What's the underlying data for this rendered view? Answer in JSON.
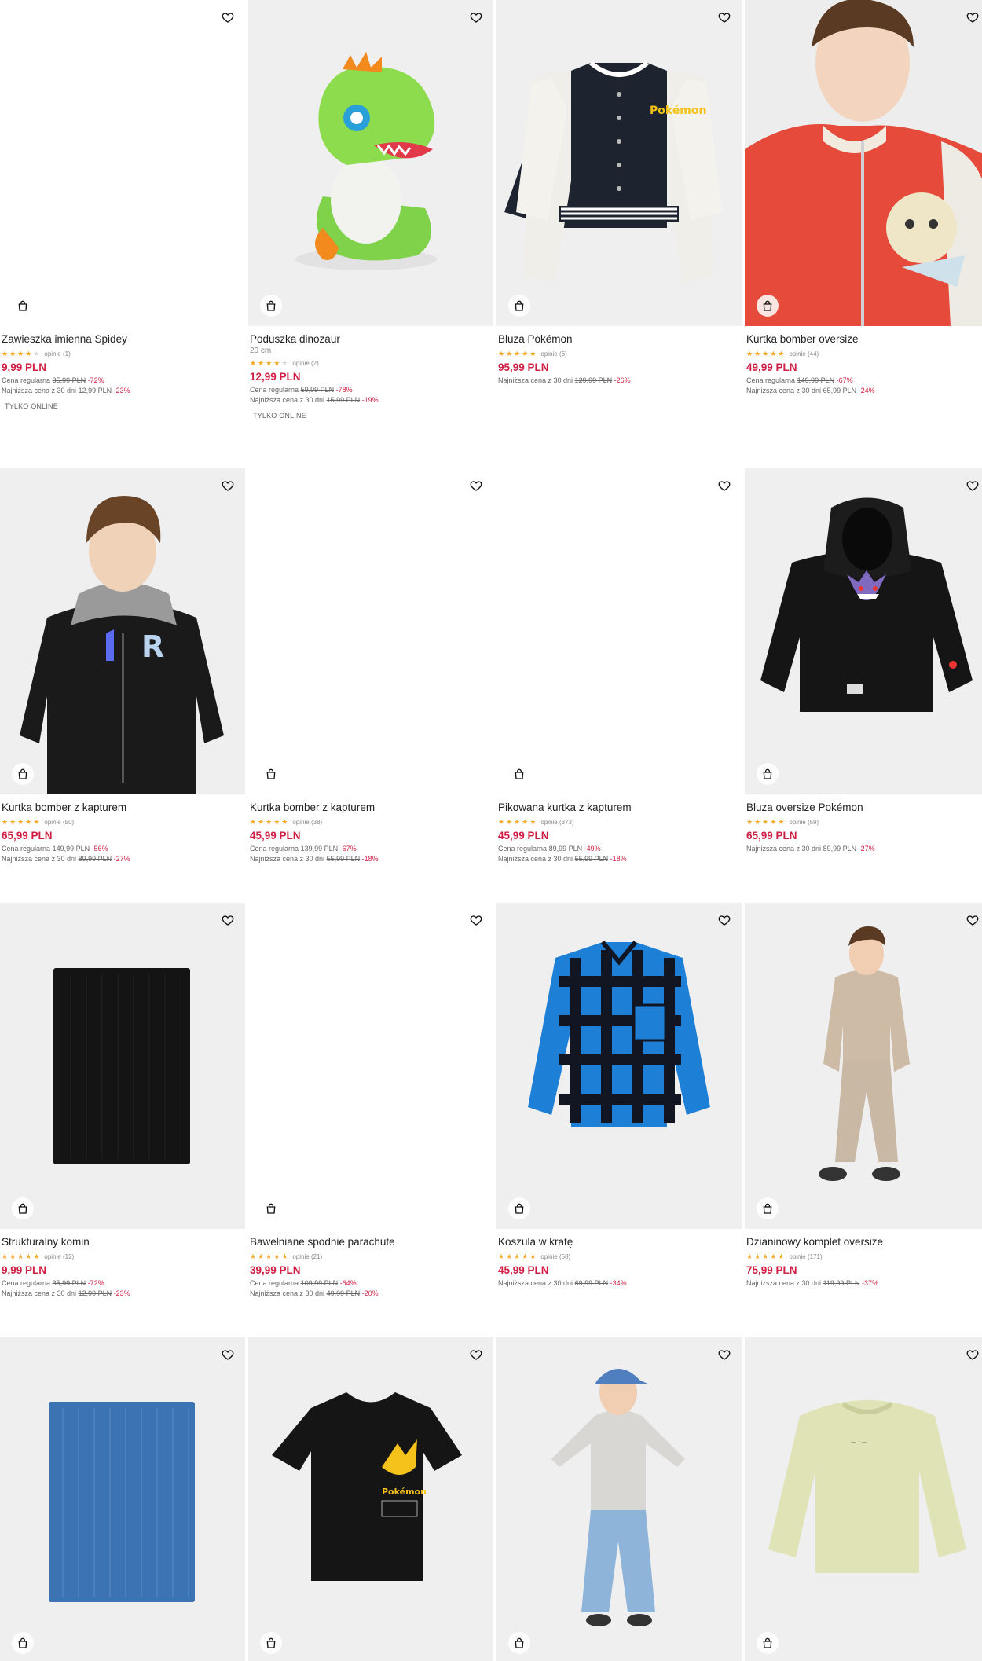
{
  "products": [
    {
      "name": "Zawieszka imienna Spidey",
      "sub": "",
      "stars": 4,
      "reviews": "opinie (1)",
      "price": "9,99 PLN",
      "lines": [
        {
          "label": "Cena regularna",
          "old": "35,99 PLN",
          "disc": "-72%"
        },
        {
          "label": "Najniższa cena z 30 dni",
          "old": "12,99 PLN",
          "disc": "-23%"
        }
      ],
      "badge": "TYLKO ONLINE"
    },
    {
      "name": "Poduszka dinozaur",
      "sub": "20 cm",
      "stars": 4,
      "reviews": "opinie (2)",
      "price": "12,99 PLN",
      "lines": [
        {
          "label": "Cena regularna",
          "old": "59,99 PLN",
          "disc": "-78%"
        },
        {
          "label": "Najniższa cena z 30 dni",
          "old": "15,99 PLN",
          "disc": "-19%"
        }
      ],
      "badge": "TYLKO ONLINE"
    },
    {
      "name": "Bluza Pokémon",
      "sub": "",
      "stars": 4.5,
      "reviews": "opinie (6)",
      "price": "95,99 PLN",
      "lines": [
        {
          "label": "Najniższa cena z 30 dni",
          "old": "129,99 PLN",
          "disc": "-26%"
        }
      ],
      "badge": ""
    },
    {
      "name": "Kurtka bomber oversize",
      "sub": "",
      "stars": 5,
      "reviews": "opinie (44)",
      "price": "49,99 PLN",
      "lines": [
        {
          "label": "Cena regularna",
          "old": "149,99 PLN",
          "disc": "-67%"
        },
        {
          "label": "Najniższa cena z 30 dni",
          "old": "65,99 PLN",
          "disc": "-24%"
        }
      ],
      "badge": ""
    },
    {
      "name": "Kurtka bomber z kapturem",
      "sub": "",
      "stars": 5,
      "reviews": "opinie (50)",
      "price": "65,99 PLN",
      "lines": [
        {
          "label": "Cena regularna",
          "old": "149,99 PLN",
          "disc": "-56%"
        },
        {
          "label": "Najniższa cena z 30 dni",
          "old": "89,99 PLN",
          "disc": "-27%"
        }
      ],
      "badge": ""
    },
    {
      "name": "Kurtka bomber z kapturem",
      "sub": "",
      "stars": 5,
      "reviews": "opinie (38)",
      "price": "45,99 PLN",
      "lines": [
        {
          "label": "Cena regularna",
          "old": "139,99 PLN",
          "disc": "-67%"
        },
        {
          "label": "Najniższa cena z 30 dni",
          "old": "55,99 PLN",
          "disc": "-18%"
        }
      ],
      "badge": ""
    },
    {
      "name": "Pikowana kurtka z kapturem",
      "sub": "",
      "stars": 4.5,
      "reviews": "opinie (373)",
      "price": "45,99 PLN",
      "lines": [
        {
          "label": "Cena regularna",
          "old": "89,99 PLN",
          "disc": "-49%"
        },
        {
          "label": "Najniższa cena z 30 dni",
          "old": "55,99 PLN",
          "disc": "-18%"
        }
      ],
      "badge": ""
    },
    {
      "name": "Bluza oversize Pokémon",
      "sub": "",
      "stars": 5,
      "reviews": "opinie (59)",
      "price": "65,99 PLN",
      "lines": [
        {
          "label": "Najniższa cena z 30 dni",
          "old": "89,99 PLN",
          "disc": "-27%"
        }
      ],
      "badge": ""
    },
    {
      "name": "Strukturalny komin",
      "sub": "",
      "stars": 5,
      "reviews": "opinie (12)",
      "price": "9,99 PLN",
      "lines": [
        {
          "label": "Cena regularna",
          "old": "35,99 PLN",
          "disc": "-72%"
        },
        {
          "label": "Najniższa cena z 30 dni",
          "old": "12,99 PLN",
          "disc": "-23%"
        }
      ],
      "badge": ""
    },
    {
      "name": "Bawełniane spodnie parachute",
      "sub": "",
      "stars": 5,
      "reviews": "opinie (21)",
      "price": "39,99 PLN",
      "lines": [
        {
          "label": "Cena regularna",
          "old": "109,99 PLN",
          "disc": "-64%"
        },
        {
          "label": "Najniższa cena z 30 dni",
          "old": "49,99 PLN",
          "disc": "-20%"
        }
      ],
      "badge": ""
    },
    {
      "name": "Koszula w kratę",
      "sub": "",
      "stars": 5,
      "reviews": "opinie (58)",
      "price": "45,99 PLN",
      "lines": [
        {
          "label": "Najniższa cena z 30 dni",
          "old": "69,99 PLN",
          "disc": "-34%"
        }
      ],
      "badge": ""
    },
    {
      "name": "Dzianinowy komplet oversize",
      "sub": "",
      "stars": 5,
      "reviews": "opinie (171)",
      "price": "75,99 PLN",
      "lines": [
        {
          "label": "Najniższa cena z 30 dni",
          "old": "119,99 PLN",
          "disc": "-37%"
        }
      ],
      "badge": ""
    },
    {
      "name": "",
      "sub": "",
      "stars": 0,
      "reviews": "",
      "price": "",
      "lines": [],
      "badge": ""
    },
    {
      "name": "",
      "sub": "",
      "stars": 0,
      "reviews": "",
      "price": "",
      "lines": [],
      "badge": ""
    },
    {
      "name": "",
      "sub": "",
      "stars": 0,
      "reviews": "",
      "price": "",
      "lines": [],
      "badge": ""
    },
    {
      "name": "",
      "sub": "",
      "stars": 0,
      "reviews": "",
      "price": "",
      "lines": [],
      "badge": ""
    }
  ],
  "icons": {
    "favorite": "heart-icon",
    "cart": "shopping-bag-icon",
    "rating": "star-icon"
  },
  "colors": {
    "price": "#cf2044",
    "discount": "#cf2044",
    "star": "#f5a623",
    "image_bg": "#efeff0"
  }
}
